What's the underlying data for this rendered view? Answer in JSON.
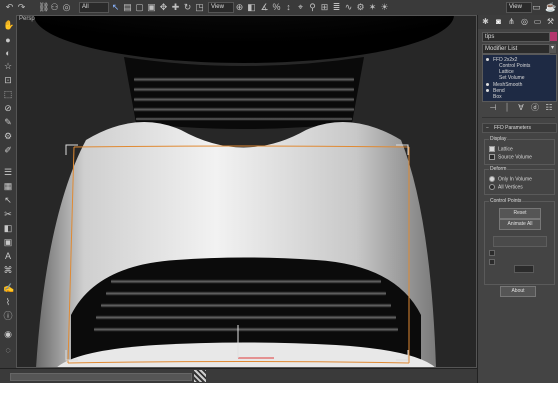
{
  "toolbar": {
    "selection_filter": "All",
    "view_left": "View",
    "view_right": "View",
    "icons": [
      "undo-icon",
      "redo-icon",
      "link-icon",
      "unlink-icon",
      "bind-icon",
      "select-icon",
      "select-by-name-icon",
      "select-region-icon",
      "window-crossing-icon",
      "move-icon",
      "rotate-icon",
      "scale-icon",
      "pivot-icon",
      "select-manipulate-icon",
      "snap-icon",
      "angle-snap-icon",
      "percent-snap-icon",
      "spinner-snap-icon",
      "named-selection-icon",
      "mirror-icon",
      "align-icon",
      "layer-icon",
      "curve-editor-icon",
      "schematic-icon",
      "material-editor-icon",
      "render-setup-icon",
      "render-frame-icon",
      "render-icon"
    ]
  },
  "viewport": {
    "label": "Persp"
  },
  "command_panel": {
    "tabs": [
      "create-icon",
      "modify-icon",
      "hierarchy-icon",
      "motion-icon",
      "display-icon",
      "utilities-icon"
    ],
    "object_name": "tips",
    "object_color": "#b4376e",
    "modifier_list": "Modifier List",
    "stack": [
      {
        "label": "FFD 2x2x2",
        "level": 0
      },
      {
        "label": "Control Points",
        "level": 1
      },
      {
        "label": "Lattice",
        "level": 1
      },
      {
        "label": "Set Volume",
        "level": 1
      },
      {
        "label": "MeshSmooth",
        "level": 0
      },
      {
        "label": "Bend",
        "level": 0
      },
      {
        "label": "Box",
        "level": 0
      }
    ],
    "ffd_rollout": {
      "title": "FFD Parameters",
      "display_group": "Display",
      "lattice": "Lattice",
      "source_volume": "Source Volume",
      "deform_group": "Deform",
      "only_in_volume": "Only In Volume",
      "all_vertices": "All Vertices",
      "control_points_group": "Control Points",
      "reset": "Reset",
      "animate_all": "Animate All",
      "about": "About"
    }
  }
}
